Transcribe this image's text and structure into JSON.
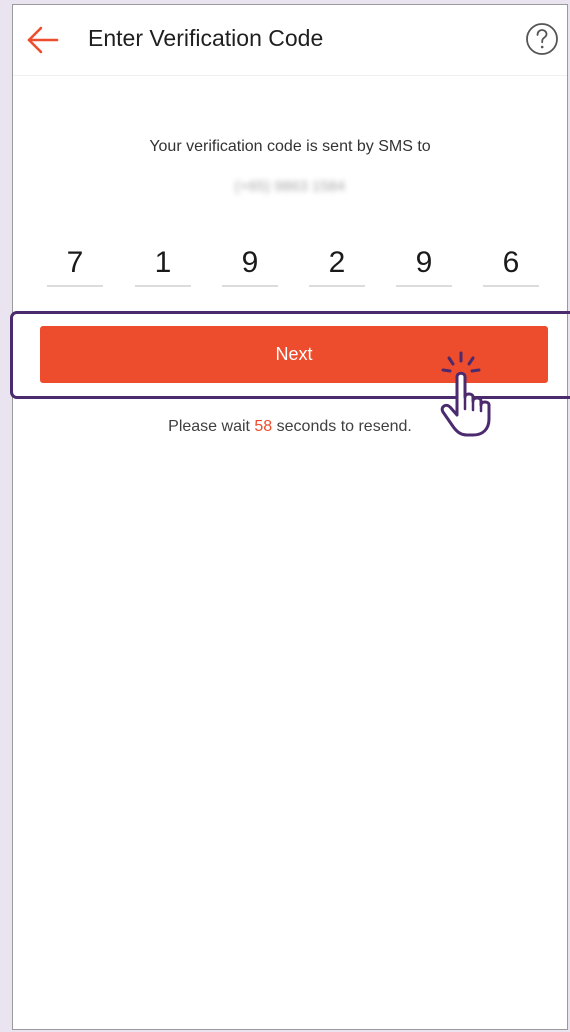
{
  "header": {
    "title": "Enter Verification Code",
    "back_icon": "arrow-left-icon",
    "help_icon": "question-circle-icon"
  },
  "subtitle": "Your verification code is sent by SMS to",
  "phone": "(+65) 9863 1584",
  "otp": {
    "digits": [
      "7",
      "1",
      "9",
      "2",
      "9",
      "6"
    ]
  },
  "next_button": {
    "label": "Next"
  },
  "resend": {
    "prefix": "Please wait ",
    "seconds": "58",
    "suffix": " seconds to resend."
  },
  "annotations": {
    "click_icon": "pointer-hand-click-icon",
    "highlight_color": "#4b2a6d"
  },
  "colors": {
    "accent": "#ee4d2d",
    "background": "#e9e4f0"
  }
}
